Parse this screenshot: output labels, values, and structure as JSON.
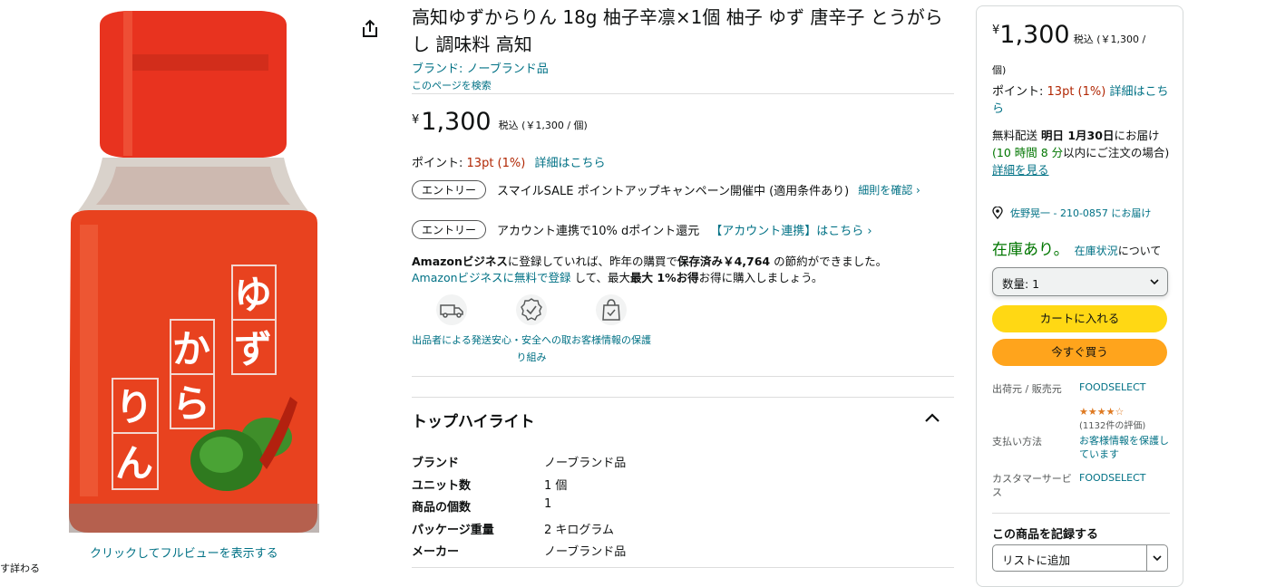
{
  "product": {
    "title": "高知ゆずからりん 18g 柚子辛凛×1個 柚子 ゆず 唐辛子 とうがらし 調味料 高知",
    "brand_link": "ブランド: ノーブランド品",
    "search_page": "このページを検索",
    "label_text": [
      "ゆ",
      "ず",
      "か",
      "ら",
      "り",
      "ん"
    ],
    "fullview_link": "クリックしてフルビューを表示する",
    "cutoff_text": "す詳わる"
  },
  "price": {
    "symbol": "¥",
    "amount": "1,300",
    "tax_note": "税込 (￥1,300 / 個)"
  },
  "points": {
    "label": "ポイント:",
    "value": "13pt (1%)",
    "details_link": "詳細はこちら"
  },
  "campaigns": [
    {
      "pill": "エントリー",
      "text": "スマイルSALE ポイントアップキャンペーン開催中 (適用条件あり)",
      "link": "細則を確認 ›"
    },
    {
      "pill": "エントリー",
      "text": "アカウント連携で10% dポイント還元",
      "link": "【アカウント連携】はこちら ›"
    }
  ],
  "business": {
    "brand": "Amazonビジネス",
    "line1_mid": "に登録していれば、昨年の購買で",
    "saved_label": "保存済み",
    "saved_amount": "￥4,764",
    "line1_end": "の節約ができました。",
    "register_link": "Amazonビジネスに無料で登録",
    "line2_mid": "して、最大",
    "line2_bold": "最大 1%お得",
    "line2_end": "お得に購入しましょう。"
  },
  "features": [
    {
      "icon": "truck-icon",
      "label": "出品者による発送"
    },
    {
      "icon": "safety-badge-icon",
      "label": "安心・安全への取り組み"
    },
    {
      "icon": "secure-bag-icon",
      "label": "お客様情報の保護"
    }
  ],
  "highlights": {
    "title": "トップハイライト",
    "rows": [
      {
        "key": "ブランド",
        "value": "ノーブランド品"
      },
      {
        "key": "ユニット数",
        "value": "1 個"
      },
      {
        "key": "商品の個数",
        "value": "1"
      },
      {
        "key": "パッケージ重量",
        "value": "2 キログラム"
      },
      {
        "key": "メーカー",
        "value": "ノーブランド品"
      }
    ]
  },
  "buybox": {
    "unit": "個)",
    "tax_note": "税込 (￥1,300 /",
    "points_label": "ポイント:",
    "points_value": "13pt (1%)",
    "points_link": "詳細はこちら",
    "delivery_prefix": "無料配送",
    "delivery_date": "明日 1月30日",
    "delivery_suffix": "にお届け",
    "countdown": "(10 時間 8 分",
    "countdown_suffix": "以内にご注文の場合)",
    "details_link": "詳細を見る",
    "location": "佐野晃一 - 210-0857 にお届け",
    "stock": "在庫あり。",
    "stock_link": "在庫状況",
    "stock_note": "について",
    "qty_label": "数量: 1",
    "cart_button": "カートに入れる",
    "buy_button": "今すぐ買う",
    "seller_key": "出荷元 / 販売元",
    "seller_value": "FOODSELECT",
    "rating_stars": "★★★★☆",
    "rating_count": "(1132件の評価)",
    "payment_key": "支払い方法",
    "payment_value": "お客様情報を保護しています",
    "cs_key": "カスタマーサービス",
    "cs_value": "FOODSELECT",
    "record_title": "この商品を記録する",
    "list_label": "リストに追加"
  },
  "colors": {
    "link": "#007185",
    "price_red": "#b12704",
    "cart_yellow": "#ffd814",
    "buy_orange": "#ffa41c",
    "stock_green": "#007600",
    "rating_star": "#de7921"
  }
}
